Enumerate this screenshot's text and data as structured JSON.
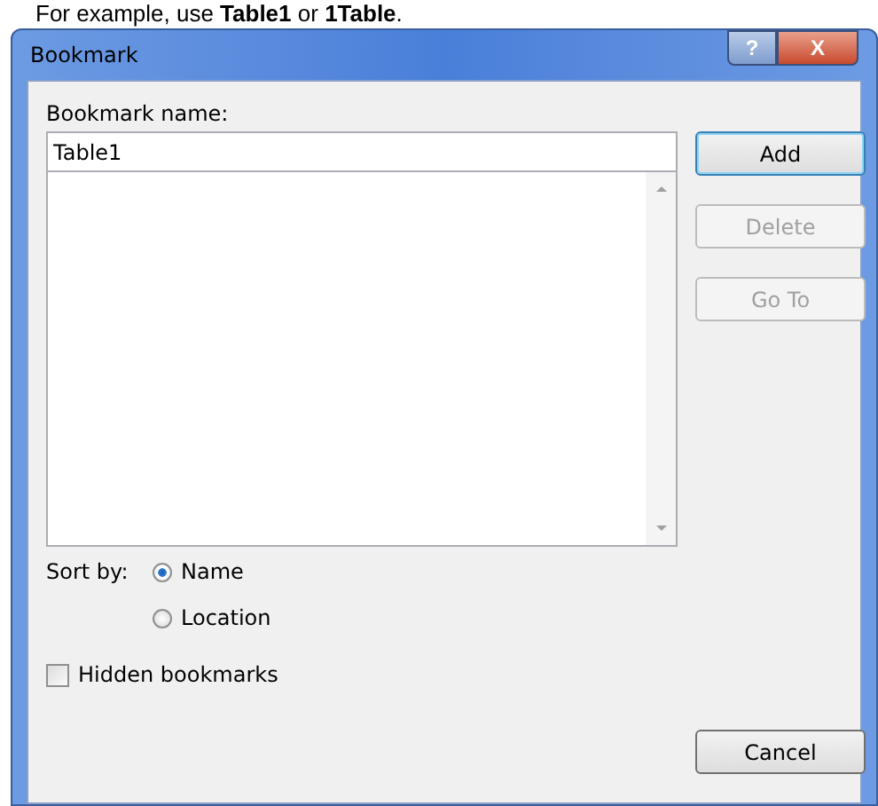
{
  "caption": "For example, use **Table1** or **1Table**.",
  "window": {
    "title": "Bookmark",
    "title_buttons": [
      {
        "kind": "help",
        "label": "?"
      },
      {
        "kind": "close",
        "label": "X"
      }
    ]
  },
  "name_field": {
    "label": "Bookmark name:",
    "value": "Table1"
  },
  "buttons": [
    {
      "label": "Add",
      "default": true,
      "disabled": false
    },
    {
      "label": "Delete",
      "default": false,
      "disabled": true
    },
    {
      "label": "Go To",
      "default": false,
      "disabled": true
    }
  ],
  "sort_by": {
    "label": "Sort by:",
    "options": [
      {
        "label": "Name",
        "selected": true
      },
      {
        "label": "Location",
        "selected": false
      }
    ]
  },
  "hidden_bookmarks": {
    "label": "Hidden bookmarks",
    "checked": false
  },
  "cancel_button": {
    "label": "Cancel"
  }
}
